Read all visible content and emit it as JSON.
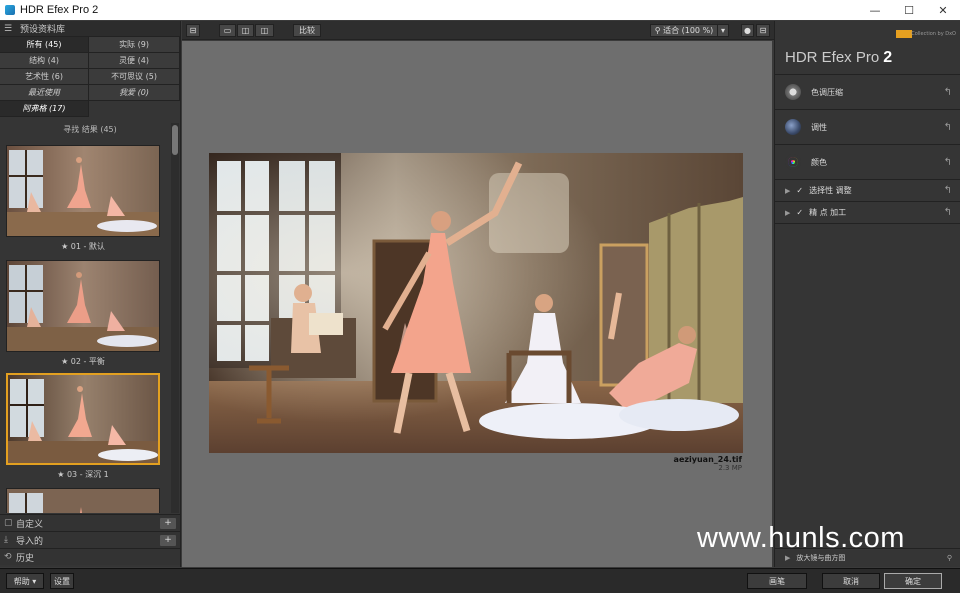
{
  "window": {
    "title": "HDR Efex Pro 2",
    "min": "—",
    "max": "☐",
    "close": "✕"
  },
  "left": {
    "preset_library": "预设资料库",
    "categories": [
      {
        "label": "所有 (45)",
        "active": true
      },
      {
        "label": "实际 (9)"
      },
      {
        "label": "结构 (4)"
      },
      {
        "label": "灵便 (4)"
      },
      {
        "label": "艺术性 (6)"
      },
      {
        "label": "不可思议 (5)"
      },
      {
        "label": "最近使用",
        "italic": true
      },
      {
        "label": "我爱 (0)",
        "italic": true
      },
      {
        "label": "阿弗格 (17)",
        "italic": true
      }
    ],
    "results": "寻找 结果 (45)",
    "thumbs": [
      {
        "caption": "★ 01 - 默认"
      },
      {
        "caption": "★ 02 - 平衡"
      },
      {
        "caption": "★ 03 - 深沉 1"
      }
    ],
    "custom": "自定义",
    "imported": "导入的",
    "history": "历史",
    "add": "+"
  },
  "toolbar": {
    "compare": "比较",
    "zoom": "适合 (100 %)",
    "zoom_arrow": "▾"
  },
  "image": {
    "filename": "aeziyuan_24.tif",
    "size": "2.3 MP"
  },
  "right": {
    "brand": "Collection by DxO",
    "app_name": "HDR Efex Pro",
    "app_version": "2",
    "sections": [
      {
        "label": "色调压缩",
        "icon": "sun-icon"
      },
      {
        "label": "调性",
        "icon": "tonality-icon"
      },
      {
        "label": "颜色",
        "icon": "color-wheel-icon"
      }
    ],
    "subsections": [
      {
        "label": "选择性 调整"
      },
      {
        "label": "精 点 加工"
      }
    ],
    "loupe": "放大镜与曲方图",
    "undo": "↰"
  },
  "bottom": {
    "help": "帮助",
    "settings": "设置",
    "brush": "画笔",
    "cancel": "取消",
    "ok": "确定"
  },
  "watermark": "www.hunls.com",
  "colors": {
    "selected_border": "#e3a020",
    "accent": "#e6a020"
  }
}
